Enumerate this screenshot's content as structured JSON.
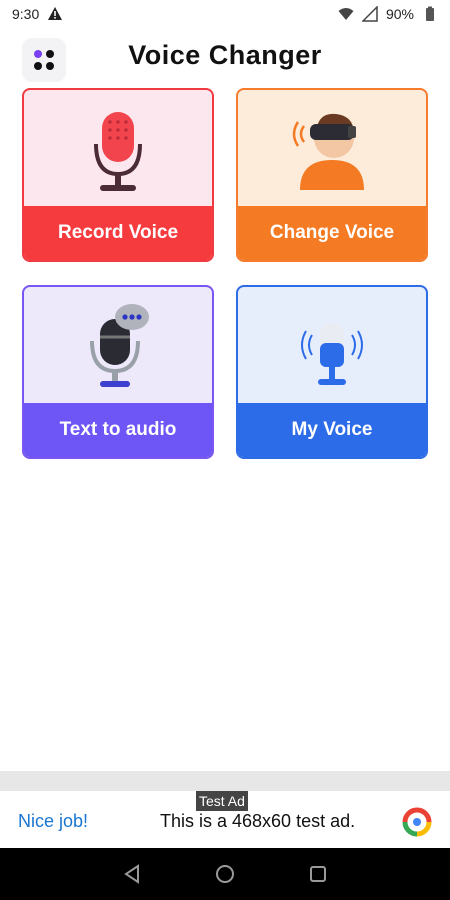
{
  "status_bar": {
    "time": "9:30",
    "battery": "90%",
    "icons": [
      "warning-icon",
      "wifi-icon",
      "signal-icon",
      "battery-icon"
    ]
  },
  "app_bar": {
    "title": "Voice Changer",
    "menu_icon": "apps-dots-icon"
  },
  "cards": [
    {
      "label": "Record Voice",
      "icon": "microphone-icon",
      "color": "#f63b3f"
    },
    {
      "label": "Change Voice",
      "icon": "vr-headset-person-icon",
      "color": "#f47a24"
    },
    {
      "label": "Text to audio",
      "icon": "mic-speech-bubble-icon",
      "color": "#6d55f6"
    },
    {
      "label": "My Voice",
      "icon": "mic-sound-waves-icon",
      "color": "#2c6ce8"
    }
  ],
  "ad": {
    "badge": "Test Ad",
    "cta": "Nice job!",
    "text": "This is a 468x60 test ad."
  },
  "nav_bar": {
    "icons": [
      "back-icon",
      "home-icon",
      "recents-icon"
    ]
  }
}
